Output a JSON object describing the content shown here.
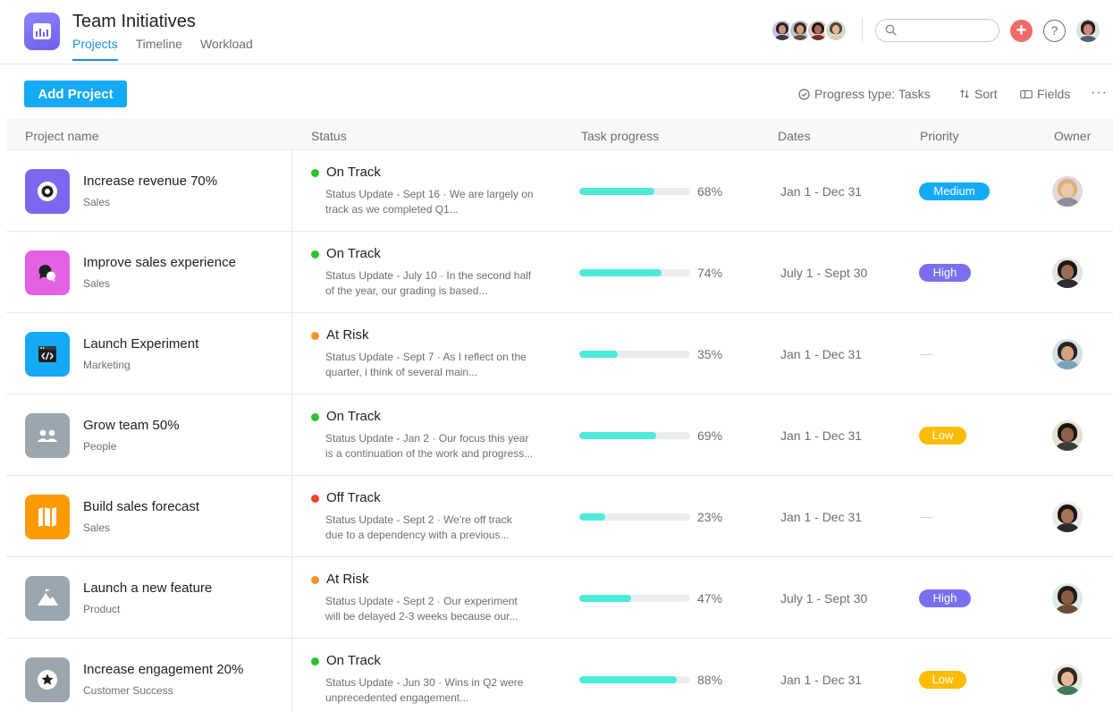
{
  "header": {
    "title": "Team Initiatives",
    "tabs": [
      {
        "label": "Projects",
        "active": true
      },
      {
        "label": "Timeline",
        "active": false
      },
      {
        "label": "Workload",
        "active": false
      }
    ],
    "search_placeholder": "",
    "add_icon": "plus-circle-icon",
    "help_label": "?"
  },
  "toolbar": {
    "add_project_label": "Add Project",
    "progress_type_label": "Progress type: Tasks",
    "sort_label": "Sort",
    "fields_label": "Fields",
    "more_label": "···"
  },
  "table": {
    "columns": [
      "Project name",
      "Status",
      "Task progress",
      "Dates",
      "Priority",
      "Owner"
    ],
    "rows": [
      {
        "name": "Increase revenue 70%",
        "team": "Sales",
        "icon": "target-icon",
        "icon_color": "#7b68ee",
        "status": "On Track",
        "status_color": "#2ec12e",
        "update_line1": "Status Update - Sept 16 · We are largely on",
        "update_line2": "track as we completed Q1...",
        "progress": 68,
        "progress_label": "68%",
        "dates": "Jan 1 - Dec 31",
        "priority": "Medium",
        "priority_color": "#14aaf5"
      },
      {
        "name": "Improve sales experience",
        "team": "Sales",
        "icon": "chat-bubbles-icon",
        "icon_color": "#e362e3",
        "status": "On Track",
        "status_color": "#2ec12e",
        "update_line1": "Status Update - July 10 · In the second half",
        "update_line2": "of the year, our grading is based...",
        "progress": 74,
        "progress_label": "74%",
        "dates": "July 1 - Sept 30",
        "priority": "High",
        "priority_color": "#7a6ff0"
      },
      {
        "name": "Launch Experiment",
        "team": "Marketing",
        "icon": "code-window-icon",
        "icon_color": "#14aaf5",
        "status": "At Risk",
        "status_color": "#f7941d",
        "update_line1": "Status Update - Sept 7 · As I reflect on the",
        "update_line2": "quarter, i think of several main...",
        "progress": 35,
        "progress_label": "35%",
        "dates": "Jan 1 - Dec 31",
        "priority": "",
        "priority_color": ""
      },
      {
        "name": "Grow team 50%",
        "team": "People",
        "icon": "people-icon",
        "icon_color": "#9ca6af",
        "status": "On Track",
        "status_color": "#2ec12e",
        "update_line1": "Status Update - Jan 2 · Our focus this year",
        "update_line2": "is a continuation of the work and progress...",
        "progress": 69,
        "progress_label": "69%",
        "dates": "Jan 1 - Dec 31",
        "priority": "Low",
        "priority_color": "#fcbd01"
      },
      {
        "name": "Build sales forecast",
        "team": "Sales",
        "icon": "map-icon",
        "icon_color": "#fd9a00",
        "status": "Off Track",
        "status_color": "#f5402c",
        "update_line1": "Status Update - Sept 2 · We're off track",
        "update_line2": "due to a dependency with a previous...",
        "progress": 23,
        "progress_label": "23%",
        "dates": "Jan 1 - Dec 31",
        "priority": "",
        "priority_color": ""
      },
      {
        "name": "Launch a new feature",
        "team": "Product",
        "icon": "mountain-flag-icon",
        "icon_color": "#9ca6af",
        "status": "At Risk",
        "status_color": "#f7941d",
        "update_line1": "Status Update - Sept 2 · Our experiment",
        "update_line2": "will be delayed 2-3 weeks because our...",
        "progress": 47,
        "progress_label": "47%",
        "dates": "July 1 - Sept 30",
        "priority": "High",
        "priority_color": "#7a6ff0"
      },
      {
        "name": "Increase engagement 20%",
        "team": "Customer Success",
        "icon": "star-icon",
        "icon_color": "#9ca6af",
        "status": "On Track",
        "status_color": "#2ec12e",
        "update_line1": "Status Update - Jun 30 · Wins in Q2 were",
        "update_line2": "unprecedented engagement...",
        "progress": 88,
        "progress_label": "88%",
        "dates": "Jan 1 - Dec 31",
        "priority": "Low",
        "priority_color": "#fcbd01"
      }
    ]
  }
}
